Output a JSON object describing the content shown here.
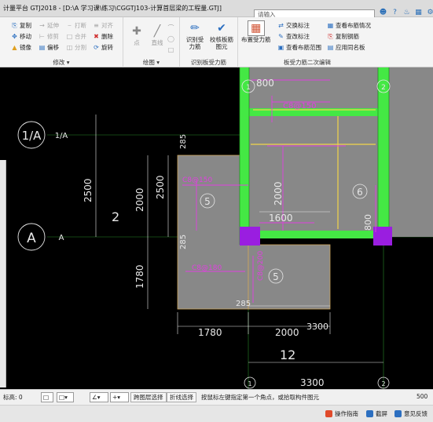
{
  "titlebar": {
    "title": "计量平台 GTJ2018 - [D:\\A 学习课\\练习\\CGGTJ103-计算首层梁的工程量.GTJ]",
    "search_placeholder": "请输入"
  },
  "ribbon": {
    "modify": {
      "label": "修改",
      "items": [
        {
          "label": "复制",
          "icon": "copy-icon",
          "enabled": true
        },
        {
          "label": "延伸",
          "icon": "extend-icon",
          "enabled": false
        },
        {
          "label": "打断",
          "icon": "break-icon",
          "enabled": false
        },
        {
          "label": "对齐",
          "icon": "align-icon",
          "enabled": false
        },
        {
          "label": "移动",
          "icon": "move-icon",
          "enabled": true
        },
        {
          "label": "修剪",
          "icon": "trim-icon",
          "enabled": false
        },
        {
          "label": "合并",
          "icon": "merge-icon",
          "enabled": false
        },
        {
          "label": "删除",
          "icon": "delete-icon",
          "enabled": true
        },
        {
          "label": "镜像",
          "icon": "mirror-icon",
          "enabled": true
        },
        {
          "label": "偏移",
          "icon": "offset-icon",
          "enabled": true
        },
        {
          "label": "分割",
          "icon": "split-icon",
          "enabled": false
        },
        {
          "label": "旋转",
          "icon": "rotate-icon",
          "enabled": true
        }
      ]
    },
    "draw": {
      "label": "绘图",
      "items": [
        {
          "label": "点",
          "icon": "point-icon"
        },
        {
          "label": "直线",
          "icon": "line-icon"
        }
      ]
    },
    "recognize": {
      "label": "识别板受力筋",
      "items": [
        {
          "label": "识别受力筋",
          "icon": "recognize-rebar-icon"
        },
        {
          "label": "校核板筋图元",
          "icon": "check-slab-icon"
        }
      ]
    },
    "secondary": {
      "label": "板受力筋二次编辑",
      "big": {
        "label": "布置受力筋",
        "icon": "place-rebar-icon"
      },
      "items": [
        {
          "label": "交换标注",
          "icon": "swap-label-icon"
        },
        {
          "label": "查改标注",
          "icon": "edit-label-icon"
        },
        {
          "label": "查看布筋范围",
          "icon": "view-range-icon"
        },
        {
          "label": "查看布筋情况",
          "icon": "view-layout-icon"
        },
        {
          "label": "复制钢筋",
          "icon": "copy-rebar-icon"
        },
        {
          "label": "应用同名板",
          "icon": "apply-same-slab-icon"
        }
      ]
    }
  },
  "canvas": {
    "axis_labels": {
      "top_1": "1",
      "top_2": "2",
      "bottom_1": "1",
      "bottom_2": "2",
      "left_1A": "1/A",
      "left_1A_small": "1/A",
      "left_A": "A",
      "left_A_small": "A"
    },
    "dimensions": {
      "d800_top": "800",
      "d2500_outer": "2500",
      "d2500_inner": "2500",
      "d2000_left": "2000",
      "d1780_left": "1780",
      "d285_top": "285",
      "d285_mid": "285",
      "d285_bottom": "285",
      "d2000_center": "2000",
      "d1600": "1600",
      "d800_right": "800",
      "d1780_bottom": "1780",
      "d2000_bottom": "2000",
      "d3300_a": "3300",
      "d3300_b": "3300"
    },
    "annotations": {
      "slab_5_left": "5",
      "slab_5_right": "5",
      "slab_6": "6",
      "grid_2": "2",
      "grid_12": "12",
      "rebar_c8_150_a": "C8@150",
      "rebar_c8_150_b": "C8@150",
      "rebar_c8_180": "C8@180",
      "rebar_c8_200": "C8@200"
    }
  },
  "statusbar": {
    "coord_prefix": "标高: 0",
    "cross_layer_btn": "跨图层选择",
    "polyline_btn": "折线选择",
    "hint": "按鼠标左键指定第一个角点，或拾取构件图元",
    "fps": "500"
  },
  "taskbar": {
    "items": [
      {
        "label": "操作指南",
        "icon": "guide-icon"
      },
      {
        "label": "截屏",
        "icon": "screenshot-icon"
      },
      {
        "label": "意见反馈",
        "icon": "feedback-icon"
      }
    ]
  }
}
